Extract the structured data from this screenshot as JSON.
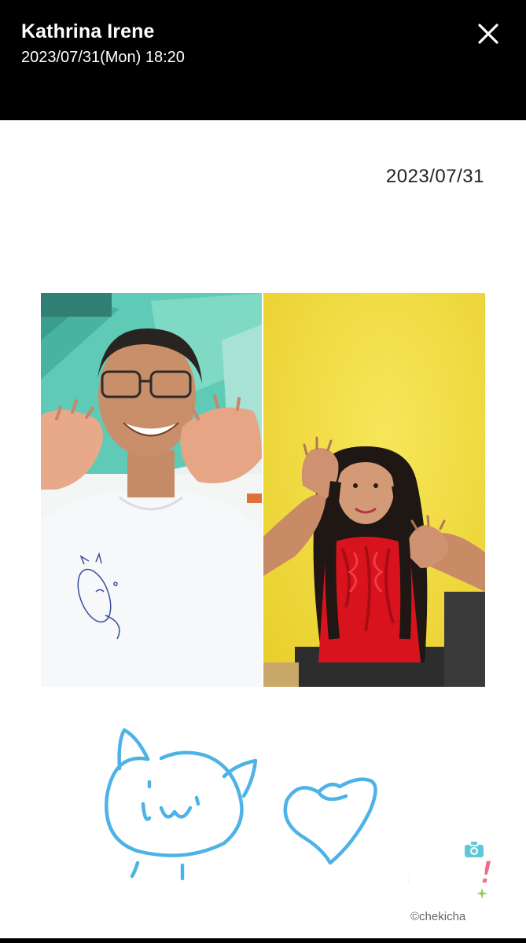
{
  "header": {
    "title": "Kathrina Irene",
    "subtitle": "2023/07/31(Mon) 18:20",
    "close_icon": "close-icon"
  },
  "card": {
    "date": "2023/07/31",
    "left_photo": "photo of fan making heart hands",
    "right_photo": "photo of idol in red dress making heart hands",
    "doodles": [
      "cat-face-doodle",
      "heart-doodle"
    ],
    "brand_logo": "チェキチャ!",
    "brand_copyright": "©chekicha",
    "colors": {
      "doodle": "#4db3e6",
      "brand": "#f06a8b",
      "left_bg": "#5fcbb6",
      "right_bg": "#f2de3a"
    }
  }
}
